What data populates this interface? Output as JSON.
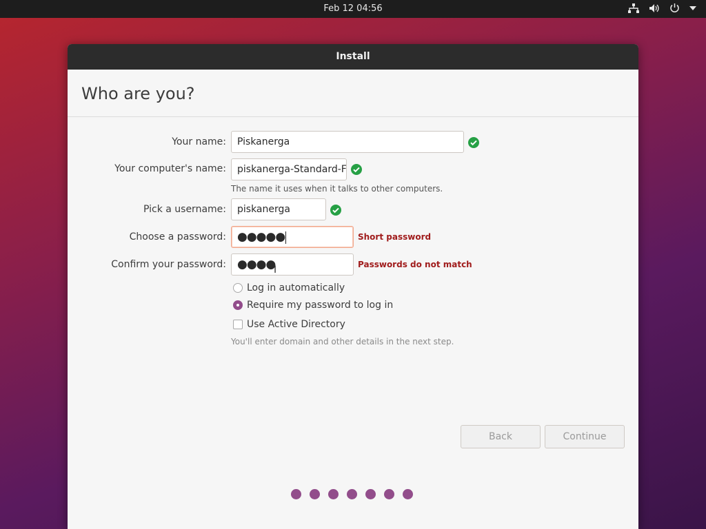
{
  "topbar": {
    "clock": "Feb 12  04:56",
    "icons": [
      "network-icon",
      "volume-icon",
      "power-icon",
      "dropdown-arrow-icon"
    ]
  },
  "window": {
    "title": "Install",
    "heading": "Who are you?"
  },
  "form": {
    "name": {
      "label": "Your name:",
      "value": "Piskanerga",
      "valid": true
    },
    "computer": {
      "label": "Your computer's name:",
      "value": "piskanerga-Standard-F",
      "valid": true,
      "hint": "The name it uses when it talks to other computers."
    },
    "username": {
      "label": "Pick a username:",
      "value": "piskanerga",
      "valid": true
    },
    "password": {
      "label": "Choose a password:",
      "value": "●●●●●",
      "error": "Short password"
    },
    "confirm": {
      "label": "Confirm your password:",
      "value": "●●●●",
      "error": "Passwords do not match"
    }
  },
  "options": {
    "login_auto": {
      "label": "Log in automatically",
      "selected": false
    },
    "require_password": {
      "label": "Require my password to log in",
      "selected": true
    },
    "active_directory": {
      "label": "Use Active Directory",
      "checked": false
    },
    "ad_hint": "You'll enter domain and other details in the next step."
  },
  "buttons": {
    "back": "Back",
    "continue": "Continue"
  },
  "progress": {
    "steps": 7,
    "current": 7
  },
  "colors": {
    "accent": "#924d8b",
    "valid": "#26a045",
    "error": "#a01c1c"
  }
}
